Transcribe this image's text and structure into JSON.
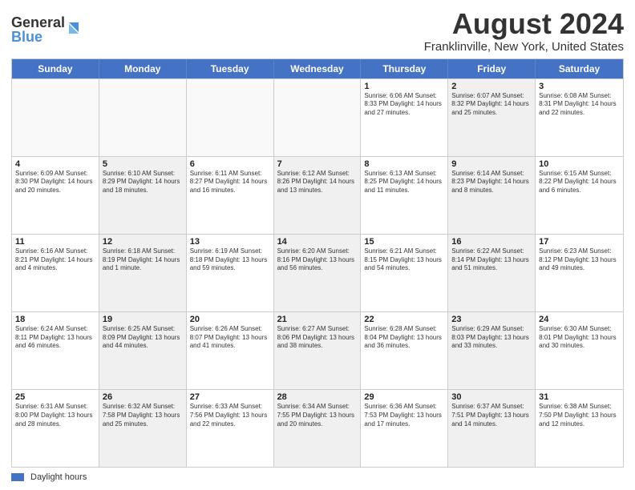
{
  "header": {
    "logo_line1": "General",
    "logo_line2": "Blue",
    "month_title": "August 2024",
    "location": "Franklinville, New York, United States"
  },
  "weekdays": [
    "Sunday",
    "Monday",
    "Tuesday",
    "Wednesday",
    "Thursday",
    "Friday",
    "Saturday"
  ],
  "weeks": [
    [
      {
        "day": "",
        "info": ""
      },
      {
        "day": "",
        "info": ""
      },
      {
        "day": "",
        "info": ""
      },
      {
        "day": "",
        "info": ""
      },
      {
        "day": "1",
        "info": "Sunrise: 6:06 AM\nSunset: 8:33 PM\nDaylight: 14 hours and 27 minutes."
      },
      {
        "day": "2",
        "info": "Sunrise: 6:07 AM\nSunset: 8:32 PM\nDaylight: 14 hours and 25 minutes."
      },
      {
        "day": "3",
        "info": "Sunrise: 6:08 AM\nSunset: 8:31 PM\nDaylight: 14 hours and 22 minutes."
      }
    ],
    [
      {
        "day": "4",
        "info": "Sunrise: 6:09 AM\nSunset: 8:30 PM\nDaylight: 14 hours and 20 minutes."
      },
      {
        "day": "5",
        "info": "Sunrise: 6:10 AM\nSunset: 8:29 PM\nDaylight: 14 hours and 18 minutes."
      },
      {
        "day": "6",
        "info": "Sunrise: 6:11 AM\nSunset: 8:27 PM\nDaylight: 14 hours and 16 minutes."
      },
      {
        "day": "7",
        "info": "Sunrise: 6:12 AM\nSunset: 8:26 PM\nDaylight: 14 hours and 13 minutes."
      },
      {
        "day": "8",
        "info": "Sunrise: 6:13 AM\nSunset: 8:25 PM\nDaylight: 14 hours and 11 minutes."
      },
      {
        "day": "9",
        "info": "Sunrise: 6:14 AM\nSunset: 8:23 PM\nDaylight: 14 hours and 8 minutes."
      },
      {
        "day": "10",
        "info": "Sunrise: 6:15 AM\nSunset: 8:22 PM\nDaylight: 14 hours and 6 minutes."
      }
    ],
    [
      {
        "day": "11",
        "info": "Sunrise: 6:16 AM\nSunset: 8:21 PM\nDaylight: 14 hours and 4 minutes."
      },
      {
        "day": "12",
        "info": "Sunrise: 6:18 AM\nSunset: 8:19 PM\nDaylight: 14 hours and 1 minute."
      },
      {
        "day": "13",
        "info": "Sunrise: 6:19 AM\nSunset: 8:18 PM\nDaylight: 13 hours and 59 minutes."
      },
      {
        "day": "14",
        "info": "Sunrise: 6:20 AM\nSunset: 8:16 PM\nDaylight: 13 hours and 56 minutes."
      },
      {
        "day": "15",
        "info": "Sunrise: 6:21 AM\nSunset: 8:15 PM\nDaylight: 13 hours and 54 minutes."
      },
      {
        "day": "16",
        "info": "Sunrise: 6:22 AM\nSunset: 8:14 PM\nDaylight: 13 hours and 51 minutes."
      },
      {
        "day": "17",
        "info": "Sunrise: 6:23 AM\nSunset: 8:12 PM\nDaylight: 13 hours and 49 minutes."
      }
    ],
    [
      {
        "day": "18",
        "info": "Sunrise: 6:24 AM\nSunset: 8:11 PM\nDaylight: 13 hours and 46 minutes."
      },
      {
        "day": "19",
        "info": "Sunrise: 6:25 AM\nSunset: 8:09 PM\nDaylight: 13 hours and 44 minutes."
      },
      {
        "day": "20",
        "info": "Sunrise: 6:26 AM\nSunset: 8:07 PM\nDaylight: 13 hours and 41 minutes."
      },
      {
        "day": "21",
        "info": "Sunrise: 6:27 AM\nSunset: 8:06 PM\nDaylight: 13 hours and 38 minutes."
      },
      {
        "day": "22",
        "info": "Sunrise: 6:28 AM\nSunset: 8:04 PM\nDaylight: 13 hours and 36 minutes."
      },
      {
        "day": "23",
        "info": "Sunrise: 6:29 AM\nSunset: 8:03 PM\nDaylight: 13 hours and 33 minutes."
      },
      {
        "day": "24",
        "info": "Sunrise: 6:30 AM\nSunset: 8:01 PM\nDaylight: 13 hours and 30 minutes."
      }
    ],
    [
      {
        "day": "25",
        "info": "Sunrise: 6:31 AM\nSunset: 8:00 PM\nDaylight: 13 hours and 28 minutes."
      },
      {
        "day": "26",
        "info": "Sunrise: 6:32 AM\nSunset: 7:58 PM\nDaylight: 13 hours and 25 minutes."
      },
      {
        "day": "27",
        "info": "Sunrise: 6:33 AM\nSunset: 7:56 PM\nDaylight: 13 hours and 22 minutes."
      },
      {
        "day": "28",
        "info": "Sunrise: 6:34 AM\nSunset: 7:55 PM\nDaylight: 13 hours and 20 minutes."
      },
      {
        "day": "29",
        "info": "Sunrise: 6:36 AM\nSunset: 7:53 PM\nDaylight: 13 hours and 17 minutes."
      },
      {
        "day": "30",
        "info": "Sunrise: 6:37 AM\nSunset: 7:51 PM\nDaylight: 13 hours and 14 minutes."
      },
      {
        "day": "31",
        "info": "Sunrise: 6:38 AM\nSunset: 7:50 PM\nDaylight: 13 hours and 12 minutes."
      }
    ]
  ],
  "footer": {
    "legend_label": "Daylight hours"
  }
}
